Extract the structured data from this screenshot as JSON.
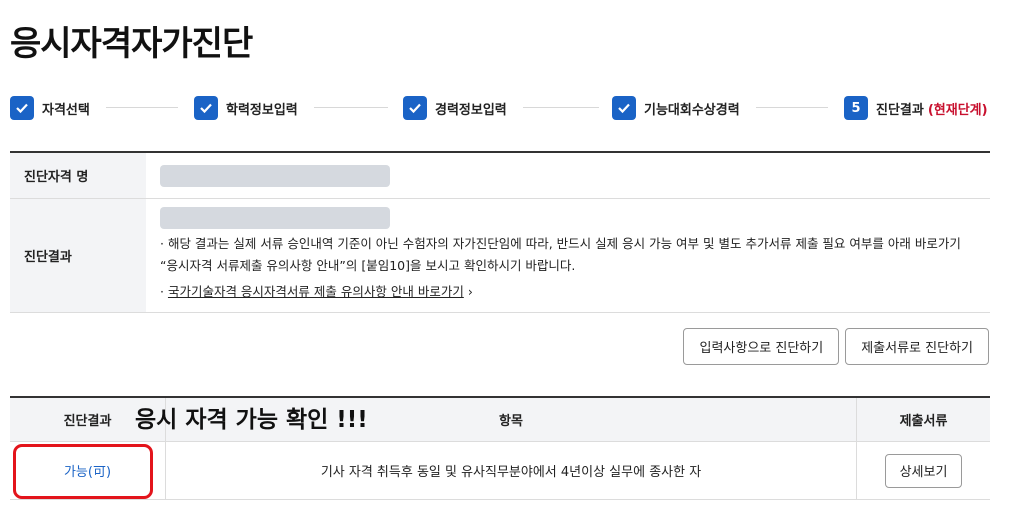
{
  "page": {
    "title": "응시자격자가진단"
  },
  "steps": [
    {
      "label": "자격선택",
      "state": "done"
    },
    {
      "label": "학력정보입력",
      "state": "done"
    },
    {
      "label": "경력정보입력",
      "state": "done"
    },
    {
      "label": "기능대회수상경력",
      "state": "done"
    },
    {
      "number": "5",
      "label": "진단결과",
      "current_label": "(현재단계)",
      "state": "current"
    }
  ],
  "info": {
    "qualification_header": "진단자격 명",
    "result_header": "진단결과",
    "note": "· 해당 결과는 실제 서류 승인내역 기준이 아닌 수험자의 자가진단임에 따라, 반드시 실제 응시 가능 여부 및 별도 추가서류 제출 필요 여부를 아래 바로가기 “응시자격 서류제출 유의사항 안내”의 [붙임10]을 보시고 확인하시기 바랍니다.",
    "link_bullet": "· ",
    "link_text": "국가기술자격 응시자격서류 제출 유의사항 안내 바로가기",
    "link_arrow": "›"
  },
  "buttons": {
    "diagnose_by_input": "입력사항으로 진단하기",
    "diagnose_by_docs": "제출서류로 진단하기"
  },
  "result_table": {
    "headers": {
      "result": "진단결과",
      "item": "항목",
      "docs": "제출서류"
    },
    "rows": [
      {
        "result": "가능(可)",
        "item": "기사 자격 취득후 동일 및 유사직무분야에서 4년이상 실무에 종사한 자",
        "docs_button": "상세보기"
      }
    ]
  },
  "annotation": {
    "text": "응시 자격 가능 확인 !!!",
    "box_color": "#e3141b"
  },
  "colors": {
    "accent": "#1a63c6",
    "current_step": "#c8102e"
  }
}
